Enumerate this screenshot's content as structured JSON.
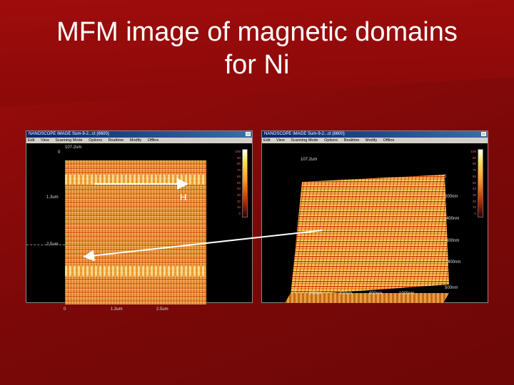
{
  "slide": {
    "title_line1": "MFM image of magnetic domains",
    "title_line2": "for Ni"
  },
  "colors": {
    "background": "#8c0a0a",
    "title_text": "#ffffff",
    "arrow": "#ffffff"
  },
  "left_window": {
    "title": "NANOSCOPE IMAGE  Sum-9-2...ct  (6600)",
    "menu": [
      "Edit",
      "View",
      "Scanning Mode",
      "Options",
      "Realtime",
      "Modify",
      "Offline"
    ],
    "axes": {
      "top_value": "107.2um",
      "y_tick_0": "0",
      "y_tick_mid": "1.3um",
      "y_tick_low": "2.5um",
      "x_tick_0": "0",
      "x_tick_1": "1.3um",
      "x_tick_2": "2.5um"
    },
    "colorbar_labels": [
      "100",
      "90",
      "80",
      "70",
      "60",
      "50",
      "40",
      "30",
      "20",
      "10",
      "0"
    ],
    "field_label": "H"
  },
  "right_window": {
    "title": "NANOSCOPE IMAGE  Sum-9-2...ct  (6600)",
    "menu": [
      "Edit",
      "View",
      "Scanning Mode",
      "Options",
      "Realtime",
      "Modify",
      "Offline"
    ],
    "axes": {
      "z_label": "107.2um",
      "z_tick_0": "0",
      "y_200": "200nm",
      "y_400": "400nm",
      "y_600": "600nm",
      "x_0": "0",
      "x_200": "200nm",
      "x_400": "400nm",
      "x_600": "600nm",
      "x_800": "800nm",
      "x_1000": "1000nm",
      "x_500": "500nm"
    },
    "colorbar_labels": [
      "100",
      "90",
      "80",
      "70",
      "60",
      "50",
      "40",
      "30",
      "20",
      "10",
      "0"
    ]
  }
}
